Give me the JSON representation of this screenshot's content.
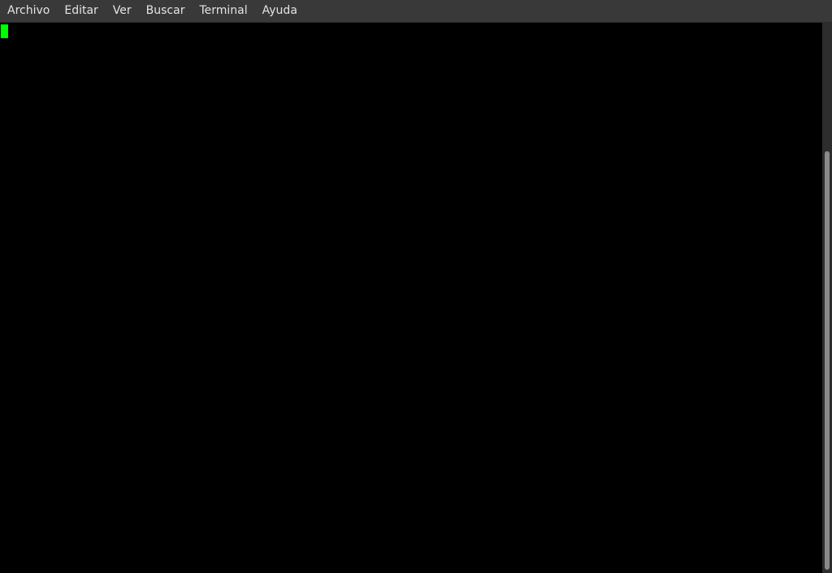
{
  "menubar": {
    "items": [
      {
        "label": "Archivo"
      },
      {
        "label": "Editar"
      },
      {
        "label": "Ver"
      },
      {
        "label": "Buscar"
      },
      {
        "label": "Terminal"
      },
      {
        "label": "Ayuda"
      }
    ]
  },
  "terminal": {
    "content": "",
    "cursor_color": "#00ff00",
    "background_color": "#000000"
  },
  "scrollbar": {
    "position": "bottom"
  }
}
